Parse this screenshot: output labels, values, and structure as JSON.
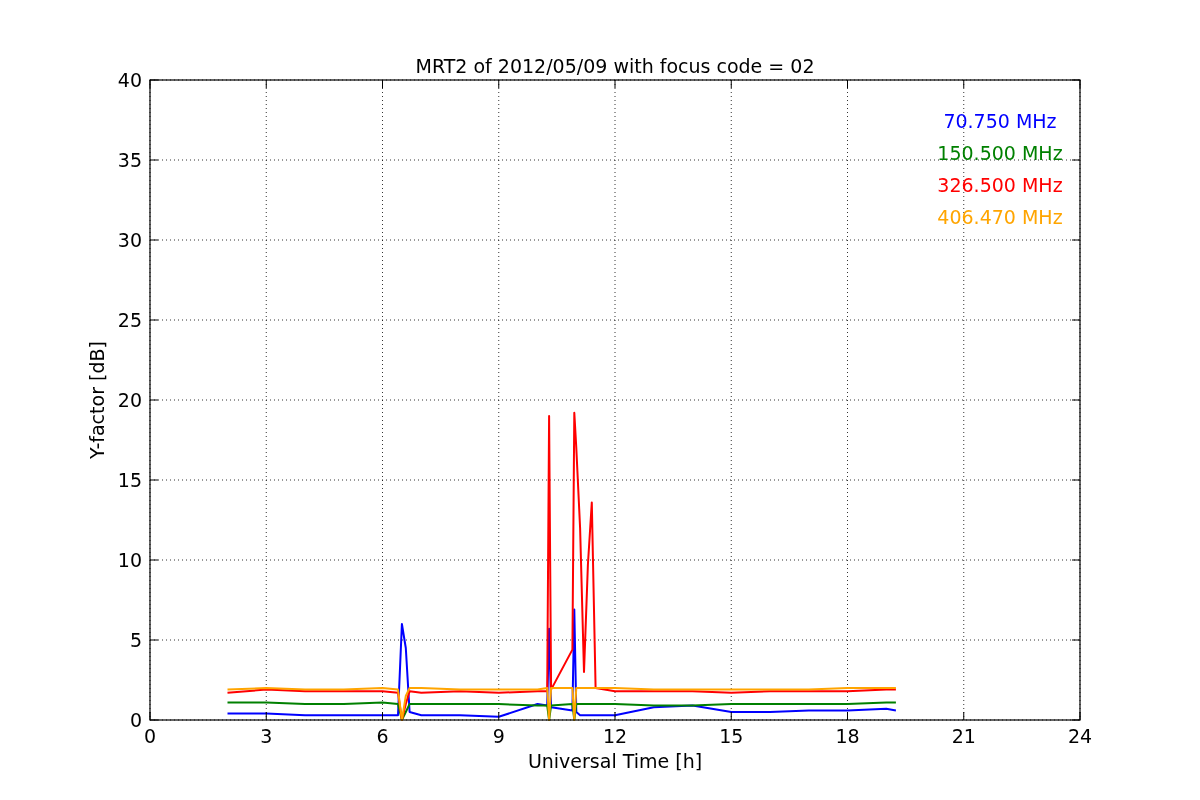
{
  "chart_data": {
    "type": "line",
    "title": "MRT2 of 2012/05/09 with focus code = 02",
    "xlabel": "Universal Time [h]",
    "ylabel": "Y-factor [dB]",
    "grid": true,
    "xlim": [
      0,
      24
    ],
    "ylim": [
      0,
      40
    ],
    "xticks": [
      0,
      3,
      6,
      9,
      12,
      15,
      18,
      21,
      24
    ],
    "yticks": [
      0,
      5,
      10,
      15,
      20,
      25,
      30,
      35,
      40
    ],
    "x": [
      2,
      3,
      4,
      5,
      6,
      6.4,
      6.5,
      6.6,
      6.7,
      7,
      8,
      9,
      10,
      10.25,
      10.3,
      10.35,
      10.9,
      10.95,
      11.0,
      11.1,
      11.2,
      11.3,
      11.4,
      11.5,
      12,
      13,
      14,
      15,
      16,
      17,
      18,
      19,
      19.25
    ],
    "series": [
      {
        "name": "70.750 MHz",
        "color": "#0000ff",
        "values": [
          0.4,
          0.4,
          0.3,
          0.3,
          0.3,
          0.3,
          6.0,
          4.5,
          0.5,
          0.3,
          0.3,
          0.2,
          1.0,
          0.9,
          5.7,
          0.8,
          0.6,
          6.9,
          0.5,
          0.3,
          0.3,
          0.3,
          0.3,
          0.3,
          0.3,
          0.8,
          0.9,
          0.5,
          0.5,
          0.6,
          0.6,
          0.7,
          0.6
        ]
      },
      {
        "name": "150.500 MHz",
        "color": "#008000",
        "values": [
          1.1,
          1.1,
          1.0,
          1.0,
          1.1,
          1.0,
          0.0,
          0.5,
          1.0,
          1.0,
          1.0,
          1.0,
          0.9,
          0.9,
          0.0,
          0.9,
          1.0,
          0.0,
          1.0,
          1.0,
          1.0,
          1.0,
          1.0,
          1.0,
          1.0,
          0.9,
          0.9,
          1.0,
          1.0,
          1.0,
          1.0,
          1.1,
          1.1
        ]
      },
      {
        "name": "326.500 MHz",
        "color": "#ff0000",
        "values": [
          1.7,
          1.9,
          1.8,
          1.8,
          1.8,
          1.7,
          0.0,
          1.0,
          1.8,
          1.7,
          1.8,
          1.7,
          1.8,
          1.8,
          19.0,
          1.9,
          4.4,
          19.2,
          17.0,
          12.0,
          3.0,
          9.7,
          13.6,
          2.0,
          1.8,
          1.8,
          1.8,
          1.7,
          1.8,
          1.8,
          1.8,
          1.9,
          1.9
        ]
      },
      {
        "name": "406.470 MHz",
        "color": "#ffa500",
        "values": [
          1.9,
          2.0,
          1.9,
          1.9,
          2.0,
          1.9,
          0.0,
          1.5,
          2.0,
          2.0,
          1.9,
          1.9,
          1.9,
          2.0,
          0.0,
          2.0,
          2.0,
          0.0,
          2.0,
          2.0,
          2.0,
          2.0,
          2.0,
          2.0,
          2.0,
          1.9,
          1.9,
          1.9,
          1.9,
          1.9,
          2.0,
          2.0,
          2.0
        ]
      }
    ]
  }
}
